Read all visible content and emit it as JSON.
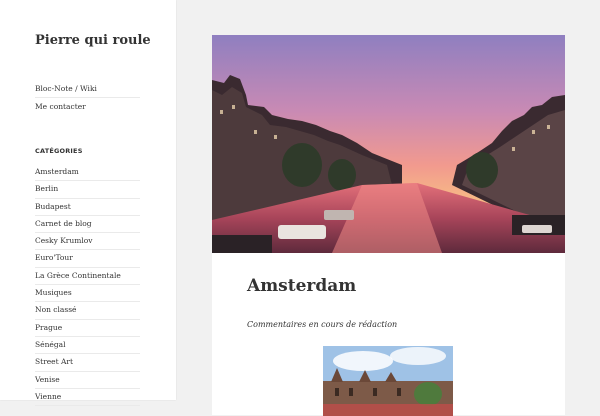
{
  "site": {
    "title": "Pierre qui roule"
  },
  "nav": {
    "items": [
      "Bloc-Note / Wiki",
      "Me contacter"
    ]
  },
  "categories": {
    "title": "CATÉGORIES",
    "items": [
      "Amsterdam",
      "Berlin",
      "Budapest",
      "Carnet de blog",
      "Cesky Krumlov",
      "Euro'Tour",
      "La Grèce Continentale",
      "Musiques",
      "Non classé",
      "Prague",
      "Sénégal",
      "Street Art",
      "Venise",
      "Vienne"
    ]
  },
  "post": {
    "title": "Amsterdam",
    "subtitle": "Commentaires en cours de rédaction"
  }
}
